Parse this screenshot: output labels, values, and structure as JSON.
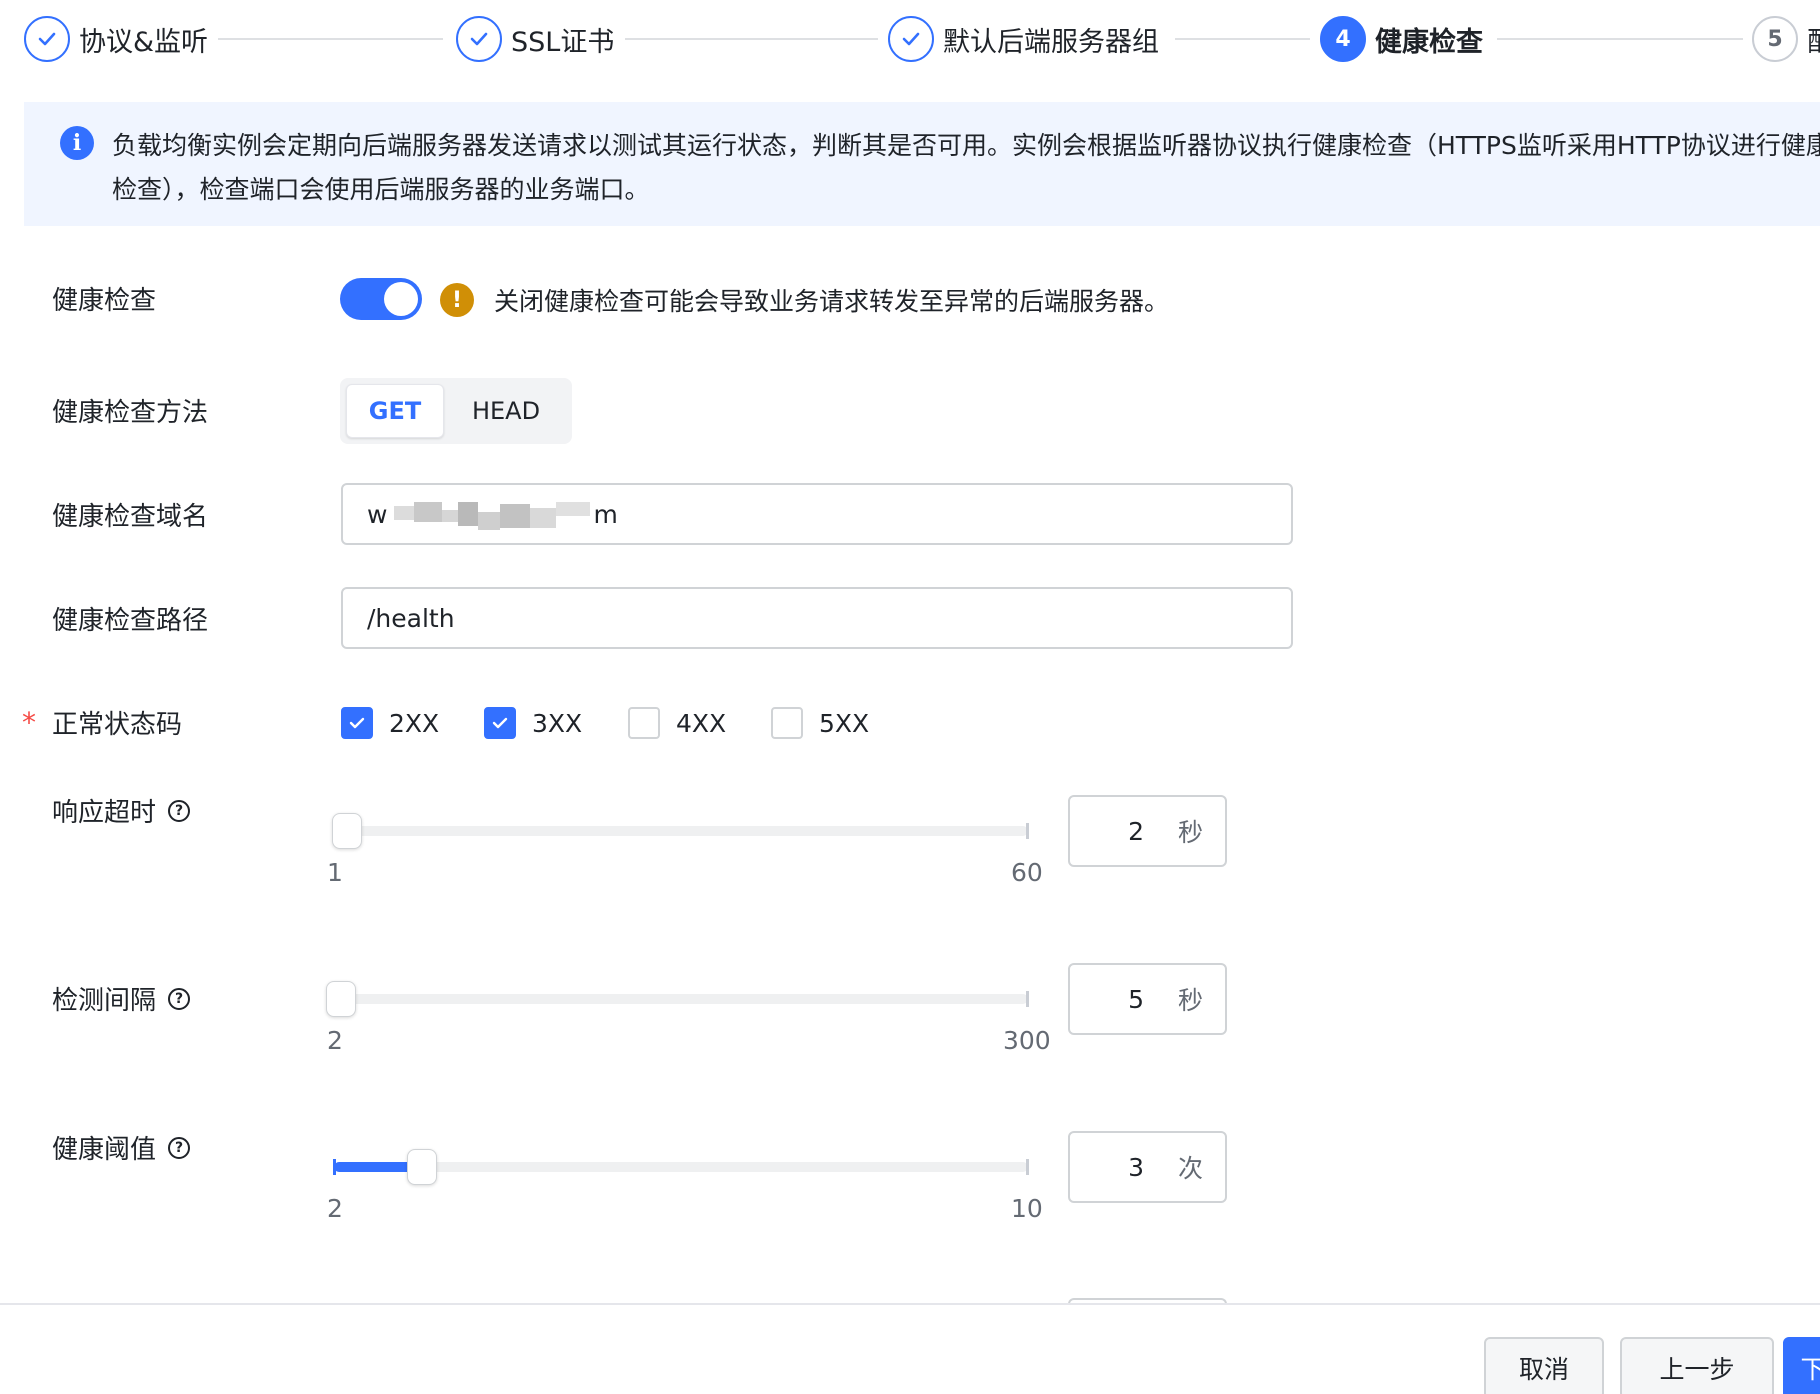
{
  "stepper": {
    "steps": [
      {
        "label": "协议&监听",
        "state": "done"
      },
      {
        "label": "SSL证书",
        "state": "done"
      },
      {
        "label": "默认后端服务器组",
        "state": "done"
      },
      {
        "label": "健康检查",
        "state": "active",
        "number": "4"
      },
      {
        "label": "配",
        "state": "todo",
        "number": "5"
      }
    ]
  },
  "banner": {
    "icon": "info-icon",
    "text": "负载均衡实例会定期向后端服务器发送请求以测试其运行状态，判断其是否可用。实例会根据监听器协议执行健康检查（HTTPS监听采用HTTP协议进行健康检查），检查端口会使用后端服务器的业务端口。"
  },
  "health_check": {
    "label": "健康检查",
    "enabled": true,
    "warning": "关闭健康检查可能会导致业务请求转发至异常的后端服务器。"
  },
  "method": {
    "label": "健康检查方法",
    "options": [
      "GET",
      "HEAD"
    ],
    "selected": "GET"
  },
  "domain": {
    "label": "健康检查域名",
    "value_prefix": "w",
    "value_suffix": "m"
  },
  "path": {
    "label": "健康检查路径",
    "value": "/health"
  },
  "status_codes": {
    "label": "正常状态码",
    "required_mark": "*",
    "options": [
      {
        "label": "2XX",
        "checked": true
      },
      {
        "label": "3XX",
        "checked": true
      },
      {
        "label": "4XX",
        "checked": false
      },
      {
        "label": "5XX",
        "checked": false
      }
    ]
  },
  "timeout": {
    "label": "响应超时",
    "help": "?",
    "min": "1",
    "max": "60",
    "value": "2",
    "unit": "秒"
  },
  "interval": {
    "label": "检测间隔",
    "help": "?",
    "min": "2",
    "max": "300",
    "value": "5",
    "unit": "秒"
  },
  "threshold": {
    "label": "健康阈值",
    "help": "?",
    "min": "2",
    "max": "10",
    "value": "3",
    "unit": "次"
  },
  "footer": {
    "cancel": "取消",
    "prev": "上一步",
    "next": "下"
  },
  "colors": {
    "accent": "#3370ff",
    "warning": "#d08f06",
    "required": "#f54a45"
  }
}
